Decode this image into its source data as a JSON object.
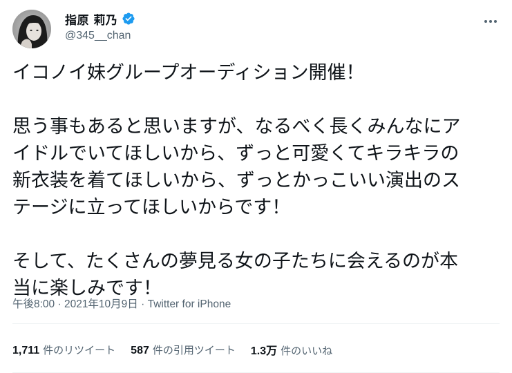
{
  "author": {
    "display_name": "指原 莉乃",
    "handle": "@345__chan",
    "verified_icon": "verified-badge-icon",
    "avatar_icon": "avatar-photo"
  },
  "header": {
    "more_icon": "more-options-icon"
  },
  "tweet": {
    "text": "イコノイ妹グループオーディション開催！\n\n思う事もあると思いますが、なるべく長くみんなにア\nイドルでいてほしいから、ずっと可愛くてキラキラの\n新衣装を着てほしいから、ずっとかっこいい演出のス\nテージに立ってほしいからです！\n\nそして、たくさんの夢見る女の子たちに会えるのが本\n当に楽しみです！"
  },
  "meta": {
    "time": "午後8:00",
    "separator1": " · ",
    "date": "2021年10月9日",
    "separator2": " · ",
    "source": "Twitter for iPhone"
  },
  "stats": {
    "retweets": {
      "count": "1,711",
      "label": "件のリツイート"
    },
    "quotes": {
      "count": "587",
      "label": "件の引用ツイート"
    },
    "likes": {
      "count": "1.3万",
      "label": "件のいいね"
    }
  },
  "colors": {
    "text_primary": "#0f1419",
    "text_secondary": "#536471",
    "verified_blue": "#1d9bf0",
    "divider": "#eff3f4"
  }
}
